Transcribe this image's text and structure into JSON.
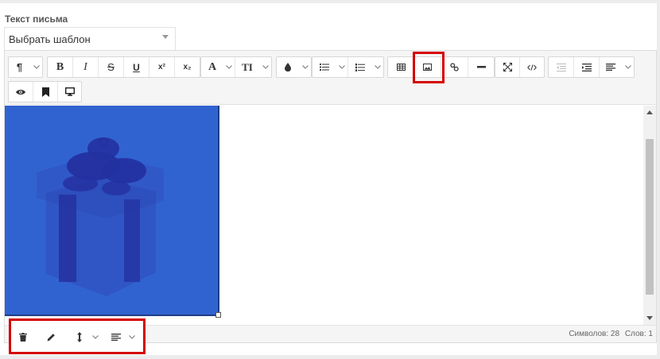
{
  "form": {
    "label": "Текст письма",
    "template_select": {
      "value": "Выбрать шаблон"
    }
  },
  "toolbar": {
    "row1": [
      {
        "id": "paragraph",
        "icon": "pilcrow-icon",
        "glyph": "¶",
        "dropdown": true
      },
      {
        "id": "bold",
        "icon": "bold-icon",
        "glyph": "B"
      },
      {
        "id": "italic",
        "icon": "italic-icon",
        "glyph": "I"
      },
      {
        "id": "strikethrough",
        "icon": "strikethrough-icon",
        "glyph": "S"
      },
      {
        "id": "underline",
        "icon": "underline-icon",
        "glyph": "U"
      },
      {
        "id": "superscript",
        "icon": "superscript-icon",
        "glyph": "x²"
      },
      {
        "id": "subscript",
        "icon": "subscript-icon",
        "glyph": "x₂"
      },
      {
        "id": "font-color",
        "icon": "font-color-icon",
        "glyph": "A",
        "dropdown": true
      },
      {
        "id": "font-size",
        "icon": "font-size-icon",
        "glyph": "TI",
        "dropdown": true
      },
      {
        "id": "background-color",
        "icon": "drop-icon",
        "dropdown": true
      },
      {
        "id": "bullet-list",
        "icon": "bullet-list-icon",
        "dropdown": true
      },
      {
        "id": "numbered-list",
        "icon": "numbered-list-icon",
        "dropdown": true
      },
      {
        "id": "table",
        "icon": "table-icon"
      },
      {
        "id": "image",
        "icon": "image-icon"
      },
      {
        "id": "link",
        "icon": "link-icon"
      },
      {
        "id": "horizontal-rule",
        "icon": "horizontal-rule-icon"
      },
      {
        "id": "fullscreen",
        "icon": "fullscreen-icon"
      },
      {
        "id": "code-view",
        "icon": "code-icon"
      },
      {
        "id": "outdent",
        "icon": "outdent-icon"
      },
      {
        "id": "indent",
        "icon": "indent-icon"
      },
      {
        "id": "align",
        "icon": "align-left-icon",
        "dropdown": true
      }
    ],
    "row2": [
      {
        "id": "preview",
        "icon": "eye-icon"
      },
      {
        "id": "bookmark",
        "icon": "bookmark-icon"
      },
      {
        "id": "desktop-preview",
        "icon": "monitor-icon"
      }
    ]
  },
  "image_toolbar": [
    {
      "id": "delete",
      "icon": "trash-icon"
    },
    {
      "id": "edit",
      "icon": "pencil-icon"
    },
    {
      "id": "resize",
      "icon": "vertical-resize-icon",
      "dropdown": true
    },
    {
      "id": "align",
      "icon": "align-left-icon",
      "dropdown": true
    }
  ],
  "status": {
    "symbols_label": "Символов: 28",
    "words_label": "Слов: 1"
  },
  "colors": {
    "highlight": "#d40000",
    "image_background": "#3163d0",
    "gift_shape": "#2d3fae",
    "gift_ribbon": "#2430a0"
  }
}
